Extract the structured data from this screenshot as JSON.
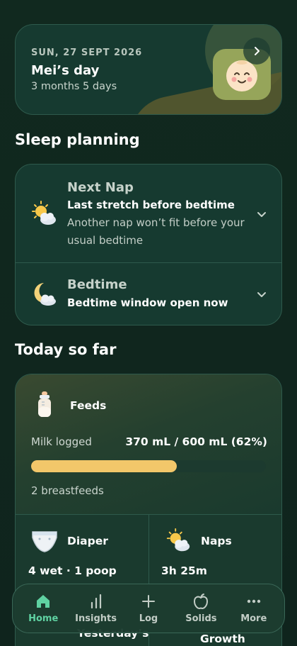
{
  "header": {
    "date": "SUN, 27 SEPT 2026",
    "title": "Mei’s day",
    "age": "3 months 5 days"
  },
  "sections": {
    "sleep_planning": "Sleep planning",
    "today_so_far": "Today so far"
  },
  "sleep": {
    "next_nap": {
      "title": "Next Nap",
      "subtitle": "Last stretch before bedtime",
      "description": "Another nap won’t fit before your usual bedtime",
      "icon": "sun-cloud-icon"
    },
    "bedtime": {
      "title": "Bedtime",
      "subtitle": "Bedtime window open now",
      "icon": "moon-cloud-icon"
    }
  },
  "today": {
    "feeds": {
      "label": "Feeds",
      "milk_label": "Milk logged",
      "milk_value": "370 mL / 600 mL (62%)",
      "milk_progress": 0.62,
      "breastfeeds": "2 breastfeeds",
      "icon": "bottle-icon"
    },
    "diaper": {
      "label": "Diaper",
      "value": "4 wet · 1 poop",
      "icon": "diaper-icon"
    },
    "naps": {
      "label": "Naps",
      "value": "3h 25m",
      "icon": "sun-cloud-icon"
    },
    "peek": {
      "left_label": "Yesterday’s",
      "right_label": "Growth"
    }
  },
  "nav": {
    "items": [
      {
        "label": "Home",
        "icon": "home-icon",
        "active": true
      },
      {
        "label": "Insights",
        "icon": "bar-chart-icon",
        "active": false
      },
      {
        "label": "Log",
        "icon": "plus-icon",
        "active": false
      },
      {
        "label": "Solids",
        "icon": "apple-icon",
        "active": false
      },
      {
        "label": "More",
        "icon": "more-dots-icon",
        "active": false
      }
    ]
  },
  "colors": {
    "background": "#0f2620",
    "card": "#163a30",
    "accent": "#5fd2a2",
    "progress": "#f2c76a"
  }
}
